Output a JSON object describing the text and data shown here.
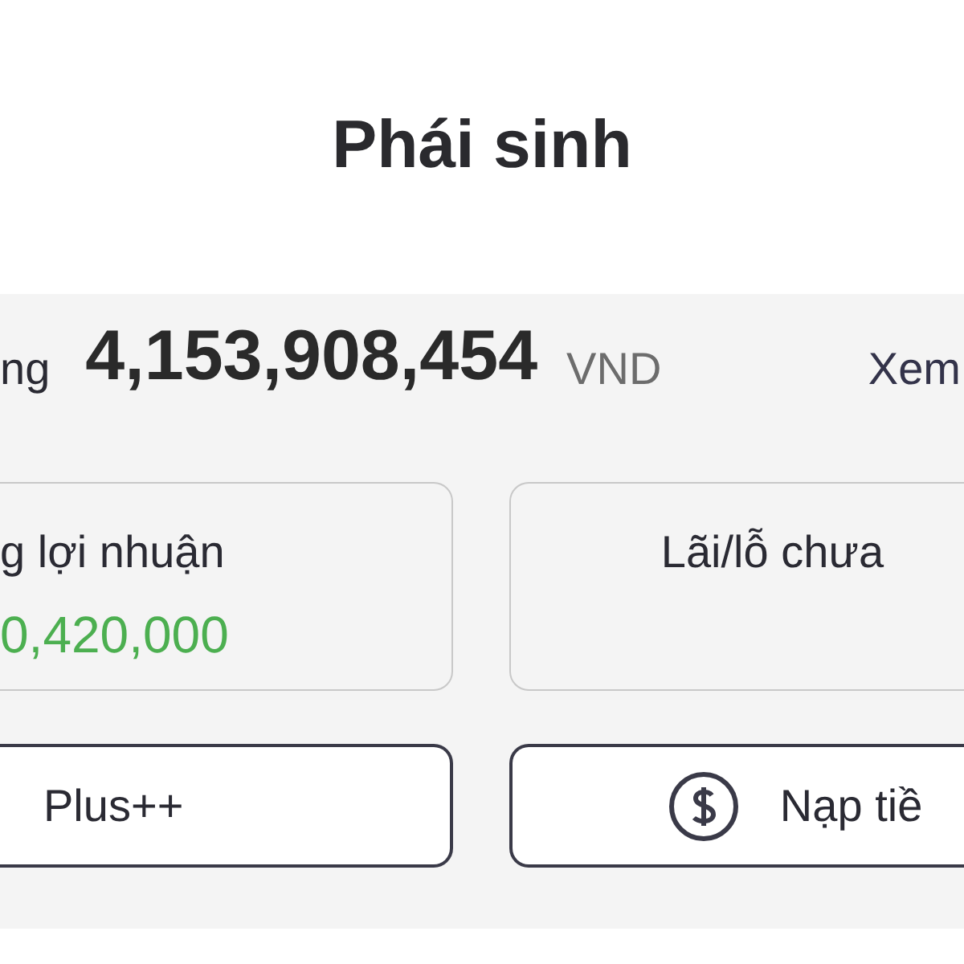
{
  "title": "Phái sinh",
  "balance": {
    "label": "ng",
    "amount": "4,153,908,454",
    "currency": "VND",
    "link": "Xem"
  },
  "cards": [
    {
      "label": "g lợi nhuận",
      "value": "0,420,000"
    },
    {
      "label": "Lãi/lỗ chưa"
    }
  ],
  "buttons": [
    {
      "label": "Plus++",
      "kind": "plain"
    },
    {
      "label": "Nạp tiề",
      "kind": "dollar"
    }
  ]
}
